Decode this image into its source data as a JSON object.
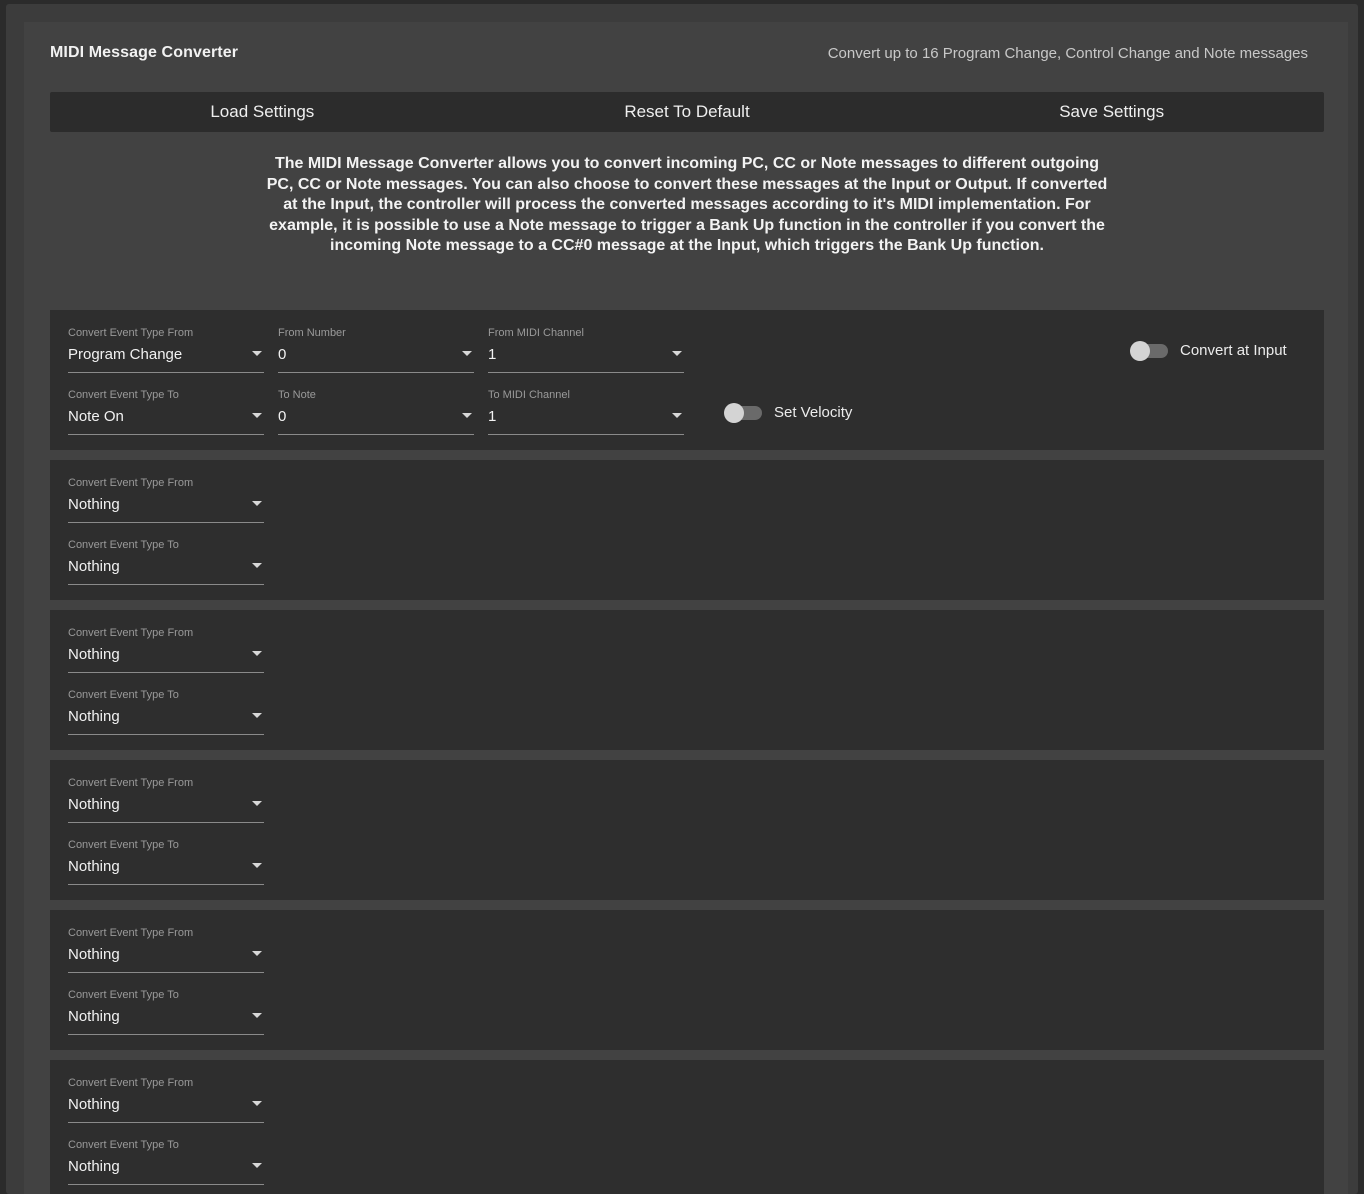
{
  "header": {
    "title": "MIDI Message Converter",
    "subtitle": "Convert up to 16 Program Change, Control Change and Note messages"
  },
  "toolbar": {
    "load_label": "Load Settings",
    "reset_label": "Reset To Default",
    "save_label": "Save Settings"
  },
  "description": "The MIDI Message Converter allows you to convert incoming PC, CC or Note messages to different outgoing PC, CC or Note messages. You can also choose to convert these messages at the Input or Output. If converted at the Input, the controller will process the converted messages according to it's MIDI implementation. For example, it is possible to use a Note message to trigger a Bank Up function in the controller if you convert the incoming Note message to a CC#0 message at the Input, which triggers the Bank Up function.",
  "rule1": {
    "from_type_label": "Convert Event Type From",
    "from_type_value": "Program Change",
    "from_number_label": "From Number",
    "from_number_value": "0",
    "from_channel_label": "From MIDI Channel",
    "from_channel_value": "1",
    "to_type_label": "Convert Event Type To",
    "to_type_value": "Note On",
    "to_note_label": "To Note",
    "to_note_value": "0",
    "to_channel_label": "To MIDI Channel",
    "to_channel_value": "1",
    "velocity_label": "Set Velocity",
    "velocity_on": false,
    "convert_input_label": "Convert at Input",
    "convert_input_on": false
  },
  "rules": [
    {
      "from_label": "Convert Event Type From",
      "from_value": "Nothing",
      "to_label": "Convert Event Type To",
      "to_value": "Nothing"
    },
    {
      "from_label": "Convert Event Type From",
      "from_value": "Nothing",
      "to_label": "Convert Event Type To",
      "to_value": "Nothing"
    },
    {
      "from_label": "Convert Event Type From",
      "from_value": "Nothing",
      "to_label": "Convert Event Type To",
      "to_value": "Nothing"
    },
    {
      "from_label": "Convert Event Type From",
      "from_value": "Nothing",
      "to_label": "Convert Event Type To",
      "to_value": "Nothing"
    },
    {
      "from_label": "Convert Event Type From",
      "from_value": "Nothing",
      "to_label": "Convert Event Type To",
      "to_value": "Nothing"
    }
  ]
}
